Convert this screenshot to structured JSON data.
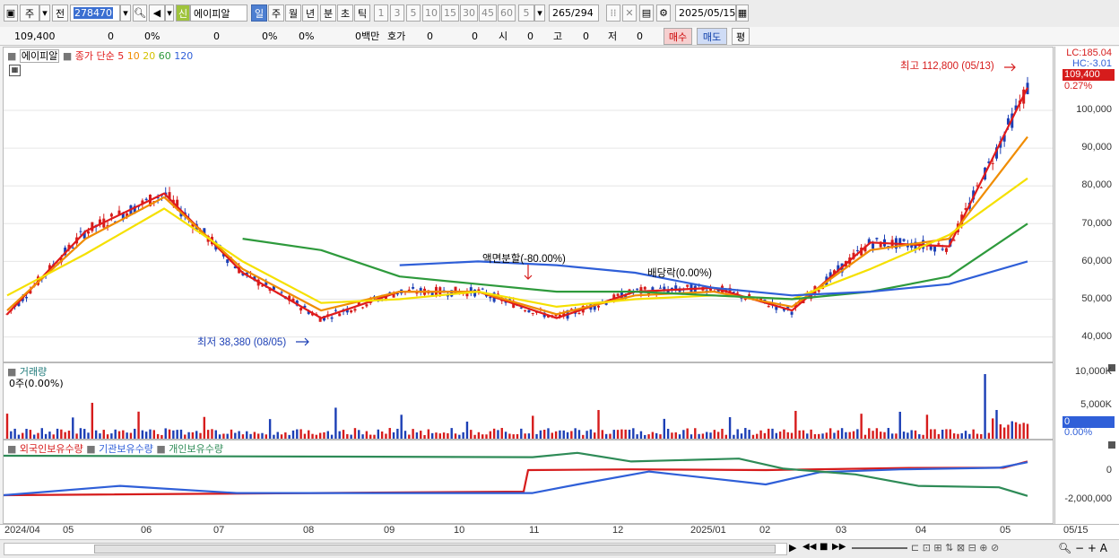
{
  "toolbar": {
    "tab_stock": "주",
    "tab_prev": "전",
    "code": "278470",
    "info_badge": "신",
    "stock_name": "에이피알",
    "periods": [
      "일",
      "주",
      "월",
      "년",
      "분",
      "초",
      "틱"
    ],
    "intervals": [
      "1",
      "3",
      "5",
      "10",
      "15",
      "30",
      "45",
      "60"
    ],
    "interval_value": "5",
    "count_display": "265",
    "count_total": "/294",
    "date": "2025/05/15"
  },
  "infobar": {
    "price": "109,400",
    "change": "0",
    "change_pct": "0%",
    "volume": "0",
    "vol_pct": "0%",
    "vol_pct2": "0%",
    "amount": "0백만",
    "quote_label": "호가",
    "quote1": "0",
    "quote2": "0",
    "open_label": "시",
    "open": "0",
    "high_label": "고",
    "high": "0",
    "low_label": "저",
    "low": "0",
    "buy": "매수",
    "sell": "매도",
    "eval": "평"
  },
  "price_panel": {
    "stock_label": "에이피알",
    "ma_label": "종가 단순",
    "ma_periods": [
      "5",
      "10",
      "20",
      "60",
      "120"
    ],
    "ma_colors": [
      "#e01b1b",
      "#f08c00",
      "#f5e000",
      "#2e9a3c",
      "#2f5fd8"
    ],
    "lc": "LC:185.04",
    "hc": "HC:-3.01",
    "current_price": "109,400",
    "current_change": "0.27%",
    "high_annot": "최고 112,800 (05/13)",
    "low_annot": "최저 38,380 (08/05)",
    "split_annot": "액면분할(-80.00%)",
    "dividend_annot": "배당락(0.00%)",
    "y_ticks": [
      "100,000",
      "90,000",
      "80,000",
      "70,000",
      "60,000",
      "50,000",
      "40,000"
    ]
  },
  "volume_panel": {
    "title": "거래량",
    "value": "0주(0.00%)",
    "y_ticks": [
      "10,000K",
      "5,000K"
    ],
    "current": "0",
    "current_pct": "0.00%"
  },
  "holdings_panel": {
    "labels": [
      "외국인보유수량",
      "기관보유수량",
      "개인보유수량"
    ],
    "colors": [
      "#d61c1c",
      "#2f5fd8",
      "#2e8b57"
    ],
    "y_ticks": [
      "0",
      "-2,000,000"
    ]
  },
  "x_axis": {
    "labels": [
      "2024/04",
      "05",
      "06",
      "07",
      "08",
      "09",
      "10",
      "11",
      "12",
      "2025/01",
      "02",
      "03",
      "04",
      "05"
    ],
    "end_label": "05/15"
  },
  "chart_data": {
    "type": "line",
    "title": "",
    "ylim": [
      35000,
      115000
    ],
    "x": [
      "2024/04",
      "2024/05",
      "2024/06",
      "2024/07",
      "2024/08",
      "2024/09",
      "2024/10",
      "2024/11",
      "2024/12",
      "2025/01",
      "2025/02",
      "2025/03",
      "2025/04",
      "2025/05"
    ],
    "series": [
      {
        "name": "5",
        "values": [
          46000,
          68000,
          78000,
          57000,
          45000,
          52000,
          52000,
          45000,
          52000,
          53000,
          47000,
          65000,
          64000,
          106000
        ]
      },
      {
        "name": "10",
        "values": [
          47000,
          66000,
          77000,
          58000,
          47000,
          52000,
          52000,
          46000,
          51000,
          52000,
          48000,
          63000,
          66000,
          93000
        ]
      },
      {
        "name": "20",
        "values": [
          51000,
          62000,
          74000,
          60000,
          49000,
          50000,
          52000,
          48000,
          50000,
          51000,
          50000,
          58000,
          67000,
          82000
        ]
      },
      {
        "name": "60",
        "values": [
          null,
          null,
          null,
          66000,
          63000,
          56000,
          54000,
          52000,
          52000,
          51000,
          50000,
          52000,
          56000,
          70000
        ]
      },
      {
        "name": "120",
        "values": [
          null,
          null,
          null,
          null,
          null,
          59000,
          60000,
          59000,
          57000,
          53000,
          51000,
          52000,
          54000,
          60000
        ]
      }
    ],
    "annotations": [
      "최고 112,800 (05/13)",
      "최저 38,380 (08/05)"
    ]
  }
}
